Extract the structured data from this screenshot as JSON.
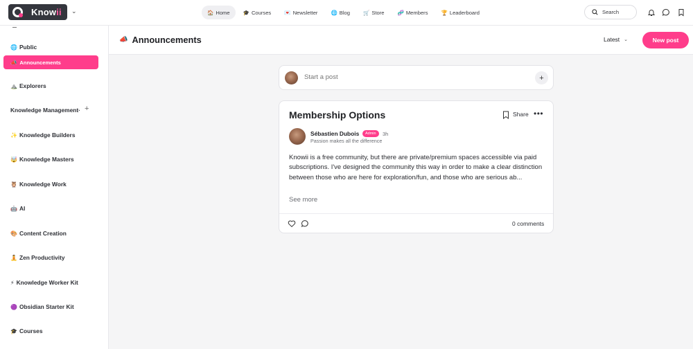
{
  "brand": {
    "name_main": "Know",
    "name_accent": "ii"
  },
  "nav": {
    "items": [
      {
        "emoji": "🏠",
        "label": "Home"
      },
      {
        "emoji": "🎓",
        "label": "Courses"
      },
      {
        "emoji": "💌",
        "label": "Newsletter"
      },
      {
        "emoji": "🌐",
        "label": "Blog"
      },
      {
        "emoji": "🛒",
        "label": "Store"
      },
      {
        "emoji": "🧬",
        "label": "Members"
      },
      {
        "emoji": "🏆",
        "label": "Leaderboard"
      }
    ],
    "active_index": 0
  },
  "search": {
    "label": "Search"
  },
  "sidebar": {
    "items": [
      {
        "emoji": "🌐",
        "label": "Public"
      },
      {
        "emoji": "📣",
        "label": "Announcements"
      },
      {
        "emoji": "⛰️",
        "label": "Explorers"
      },
      {
        "emoji": "",
        "label": "Knowledge Management·"
      },
      {
        "emoji": "✨",
        "label": "Knowledge Builders"
      },
      {
        "emoji": "🤯",
        "label": "Knowledge Masters"
      },
      {
        "emoji": "🦉",
        "label": "Knowledge Work"
      },
      {
        "emoji": "🤖",
        "label": "AI"
      },
      {
        "emoji": "🎨",
        "label": "Content Creation"
      },
      {
        "emoji": "🧘",
        "label": "Zen Productivity"
      },
      {
        "emoji": "⚡",
        "label": "Knowledge Worker Kit"
      },
      {
        "emoji": "🟣",
        "label": "Obsidian Starter Kit"
      },
      {
        "emoji": "🎓",
        "label": "Courses"
      }
    ],
    "active_label": "Announcements"
  },
  "header": {
    "emoji": "📣",
    "title": "Announcements",
    "sort_label": "Latest",
    "new_post_label": "New post"
  },
  "composer": {
    "placeholder": "Start a post"
  },
  "post": {
    "title": "Membership Options",
    "share_label": "Share",
    "author": "Sébastien Dubois",
    "badge": "Admin",
    "time": "3h",
    "tagline": "Passion makes all the difference",
    "body": "Knowii is a free community, but there are private/premium spaces accessible via paid subscriptions. I've designed the community this way in order to make a clear distinction between those who are here for exploration/fun, and those who are serious ab...",
    "see_more": "See more",
    "comments": "0 comments"
  },
  "colors": {
    "accent": "#ff3d8b",
    "logo_bg": "#34363d"
  }
}
